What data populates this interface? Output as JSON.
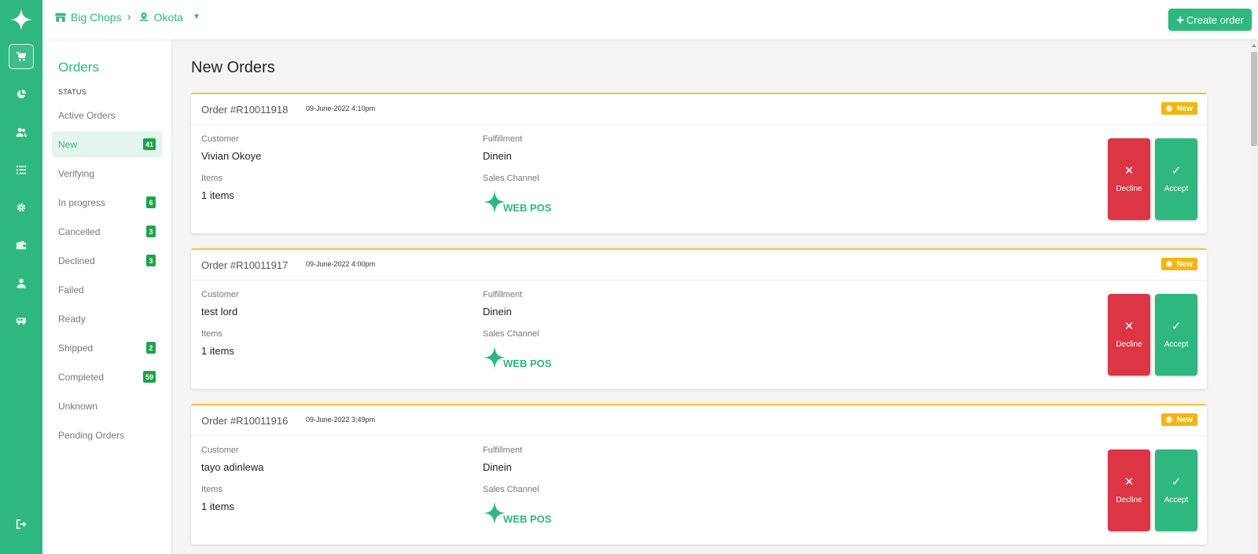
{
  "app": {
    "brand_color": "#2eb87f",
    "accent_warning": "#f5b50f",
    "danger": "#dc3545"
  },
  "rail": {
    "items": [
      {
        "icon": "cart-icon"
      },
      {
        "icon": "pie-chart-icon"
      },
      {
        "icon": "users-icon"
      },
      {
        "icon": "list-icon"
      },
      {
        "icon": "gear-icon"
      },
      {
        "icon": "wallet-icon"
      },
      {
        "icon": "user-icon"
      },
      {
        "icon": "truck-icon"
      },
      {
        "icon": "logout-icon"
      }
    ]
  },
  "topbar": {
    "store": "Big Chops",
    "location": "Okota",
    "create_label": "Create order"
  },
  "sidebar": {
    "title": "Orders",
    "status_label": "STATUS",
    "items": [
      {
        "label": "Active Orders",
        "count": ""
      },
      {
        "label": "New",
        "count": "41"
      },
      {
        "label": "Verifying",
        "count": ""
      },
      {
        "label": "In progress",
        "count": "6"
      },
      {
        "label": "Cancelled",
        "count": "3"
      },
      {
        "label": "Declined",
        "count": "3"
      },
      {
        "label": "Failed",
        "count": ""
      },
      {
        "label": "Ready",
        "count": ""
      },
      {
        "label": "Shipped",
        "count": "2"
      },
      {
        "label": "Completed",
        "count": "59"
      },
      {
        "label": "Unknown",
        "count": ""
      },
      {
        "label": "Pending Orders",
        "count": ""
      }
    ]
  },
  "main": {
    "title": "New Orders",
    "orders": [
      {
        "number": "Order #R10011918",
        "date": "09-June-2022 4:10pm",
        "badge": "New",
        "customer_label": "Customer",
        "customer": "Vivian Okoye",
        "items_label": "Items",
        "items": "1 items",
        "fulfillment_label": "Fulfillment",
        "fulfillment": "Dinein",
        "channel_label": "Sales Channel",
        "channel": "WEB POS",
        "decline": "Decline",
        "accept": "Accept"
      },
      {
        "number": "Order #R10011917",
        "date": "09-June-2022 4:00pm",
        "badge": "New",
        "customer_label": "Customer",
        "customer": "test lord",
        "items_label": "Items",
        "items": "1 items",
        "fulfillment_label": "Fulfillment",
        "fulfillment": "Dinein",
        "channel_label": "Sales Channel",
        "channel": "WEB POS",
        "decline": "Decline",
        "accept": "Accept"
      },
      {
        "number": "Order #R10011916",
        "date": "09-June-2022 3:49pm",
        "badge": "New",
        "customer_label": "Customer",
        "customer": "tayo adinlewa",
        "items_label": "Items",
        "items": "1 items",
        "fulfillment_label": "Fulfillment",
        "fulfillment": "Dinein",
        "channel_label": "Sales Channel",
        "channel": "WEB POS",
        "decline": "Decline",
        "accept": "Accept"
      }
    ]
  }
}
